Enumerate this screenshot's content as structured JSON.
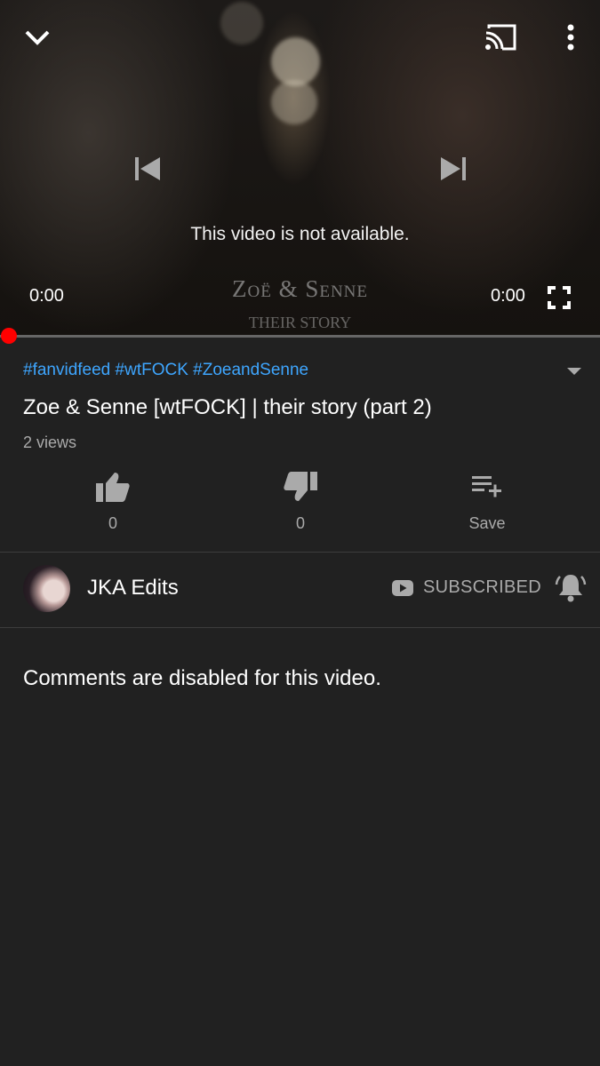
{
  "player": {
    "status_message": "This video is not available.",
    "current_time": "0:00",
    "duration": "0:00",
    "progress": 0,
    "watermark_title": "Zoë & Senne",
    "watermark_subtitle": "THEIR STORY",
    "icons": [
      "chevron-down-icon",
      "cast-icon",
      "more-vert-icon",
      "skip-previous-icon",
      "skip-next-icon",
      "fullscreen-icon"
    ]
  },
  "video": {
    "hashtags": "#fanvidfeed #wtFOCK #ZoeandSenne",
    "title": "Zoe & Senne [wtFOCK] | their story (part 2)",
    "views": "2 views"
  },
  "actions": [
    {
      "name": "like",
      "icon": "thumbs-up-icon",
      "label": "0"
    },
    {
      "name": "dislike",
      "icon": "thumbs-down-icon",
      "label": "0"
    },
    {
      "name": "save",
      "icon": "playlist-add-icon",
      "label": "Save"
    }
  ],
  "channel": {
    "name": "JKA Edits",
    "subscribe_label": "SUBSCRIBED",
    "subscribe_icon": "youtube-icon",
    "bell_icon": "bell-icon"
  },
  "comments": {
    "message": "Comments are disabled for this video."
  },
  "colors": {
    "background": "#212121",
    "accent": "#ff0000",
    "link": "#3ea6ff",
    "secondary_text": "#aaaaaa"
  }
}
